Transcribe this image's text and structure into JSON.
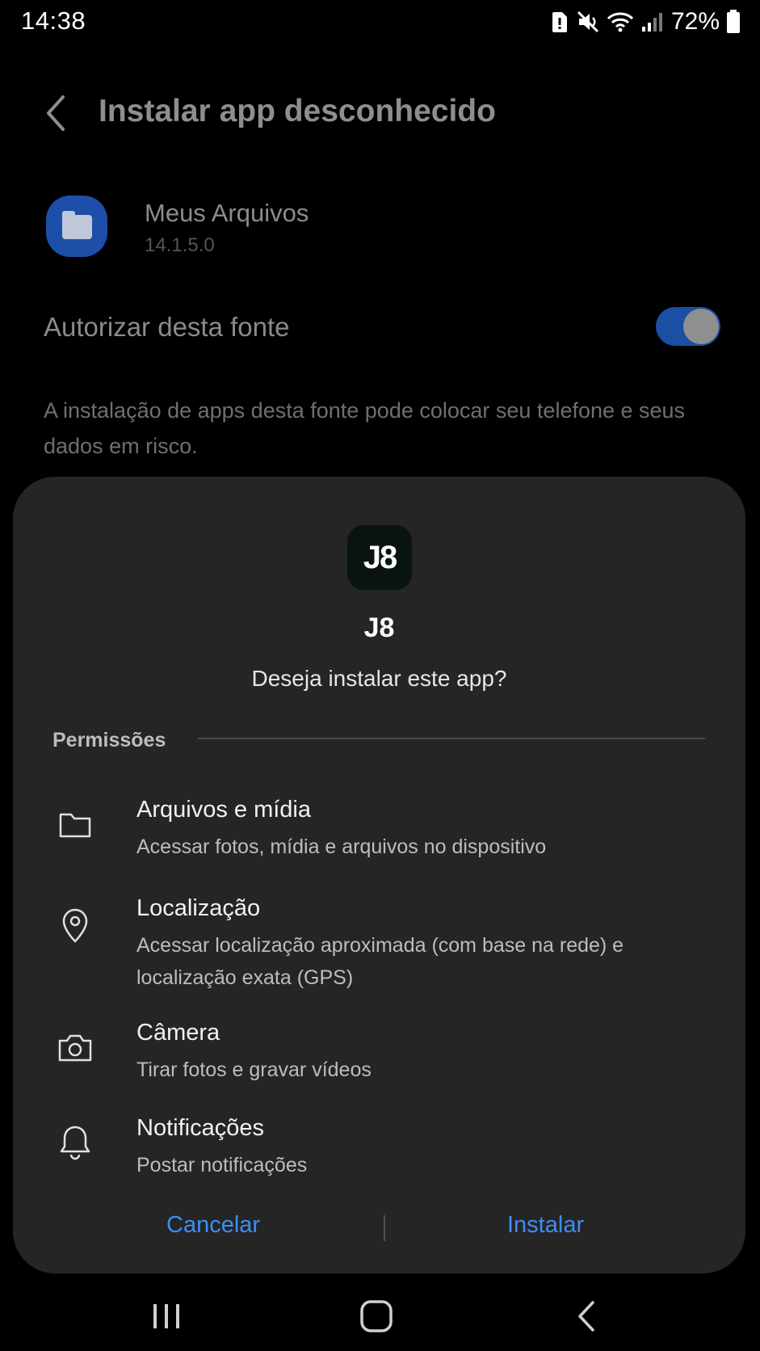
{
  "status_bar": {
    "time": "14:38",
    "battery_percent": "72%",
    "icons": [
      "sim-alert-icon",
      "mute-icon",
      "wifi-icon",
      "signal-icon",
      "battery-icon"
    ]
  },
  "settings": {
    "title": "Instalar app desconhecido",
    "app": {
      "name": "Meus Arquivos",
      "version": "14.1.5.0",
      "icon": "folder-icon"
    },
    "allow_label": "Autorizar desta fonte",
    "allow_enabled": true,
    "warning": "A instalação de apps desta fonte pode colocar seu telefone e seus dados em risco."
  },
  "dialog": {
    "app_icon_text": "J8",
    "app_name": "J8",
    "question": "Deseja instalar este app?",
    "permissions_header": "Permissões",
    "permissions": [
      {
        "icon": "folder-icon",
        "title": "Arquivos e mídia",
        "description": "Acessar fotos, mídia e arquivos no dispositivo"
      },
      {
        "icon": "location-pin-icon",
        "title": "Localização",
        "description": "Acessar localização aproximada (com base na rede) e localização exata (GPS)"
      },
      {
        "icon": "camera-icon",
        "title": "Câmera",
        "description": "Tirar fotos e gravar vídeos"
      },
      {
        "icon": "bell-icon",
        "title": "Notificações",
        "description": "Postar notificações"
      }
    ],
    "cancel_label": "Cancelar",
    "install_label": "Instalar"
  },
  "colors": {
    "accent": "#3d8df5",
    "dialog_bg": "#252525",
    "toggle_on": "#1a4fa3"
  }
}
